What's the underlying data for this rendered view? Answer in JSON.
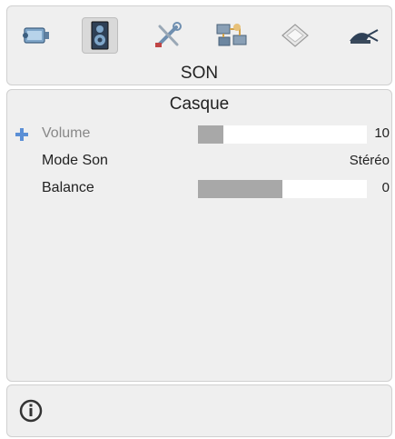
{
  "menu": {
    "icons": [
      {
        "name": "picture-icon",
        "selected": false
      },
      {
        "name": "sound-speaker-icon",
        "selected": true
      },
      {
        "name": "settings-tools-icon",
        "selected": false
      },
      {
        "name": "network-icon",
        "selected": false
      },
      {
        "name": "media-disc-icon",
        "selected": false
      },
      {
        "name": "satellite-dish-icon",
        "selected": false
      }
    ],
    "title": "SON"
  },
  "submenu": {
    "title": "Casque",
    "items": [
      {
        "label": "Volume",
        "value": "10",
        "level": 0.15,
        "active": true,
        "type": "slider"
      },
      {
        "label": "Mode Son",
        "value": "Stéréo",
        "active": false,
        "type": "option"
      },
      {
        "label": "Balance",
        "value": "0",
        "level": 0.5,
        "active": false,
        "type": "slider"
      }
    ]
  },
  "footer": {
    "icon": "info-icon"
  },
  "colors": {
    "panel_bg": "#efefef",
    "slider_fill": "#a8a8a8",
    "active_marker": "#5b8fd6",
    "inactive_label": "#888888"
  }
}
